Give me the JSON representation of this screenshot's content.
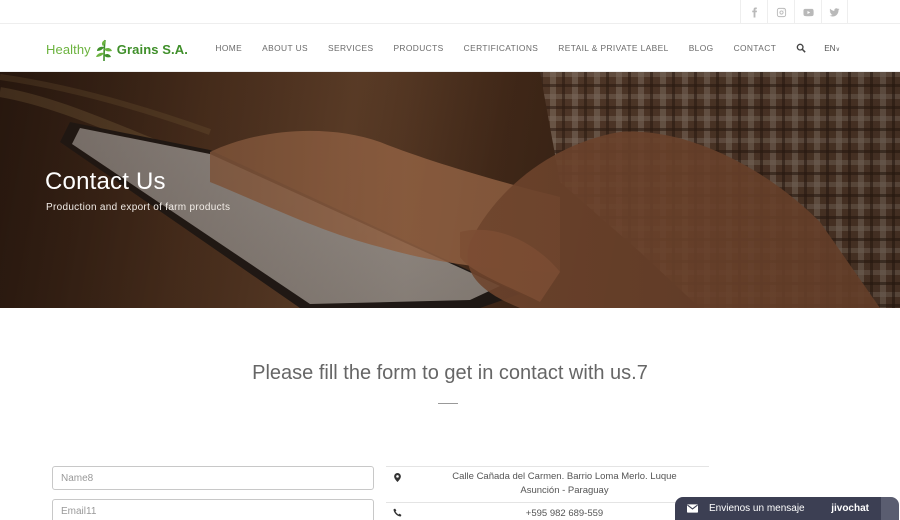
{
  "social": [
    {
      "icon": "facebook-icon"
    },
    {
      "icon": "instagram-icon"
    },
    {
      "icon": "youtube-icon"
    },
    {
      "icon": "twitter-icon"
    }
  ],
  "logo": {
    "word1": "Healthy",
    "word2": "Grains S.A."
  },
  "nav": {
    "items": [
      "HOME",
      "ABOUT US",
      "SERVICES",
      "PRODUCTS",
      "CERTIFICATIONS",
      "RETAIL & PRIVATE LABEL",
      "BLOG",
      "CONTACT"
    ],
    "lang": "EN"
  },
  "hero": {
    "title": "Contact Us",
    "subtitle": "Production and export of farm products"
  },
  "form": {
    "heading": "Please fill the form to get in contact with us.7",
    "name_placeholder": "Name8",
    "email_placeholder": "Email11"
  },
  "contact_info": {
    "address_line1": "Calle Cañada del Carmen. Barrio Loma Merlo. Luque",
    "address_line2": "Asunción - Paraguay",
    "phone": "+595 982 689-559"
  },
  "chat": {
    "message": "Envienos un mensaje",
    "brand": "jivochat"
  },
  "colors": {
    "brand_green": "#6cb33f",
    "chat_bg": "#3c3f53"
  }
}
